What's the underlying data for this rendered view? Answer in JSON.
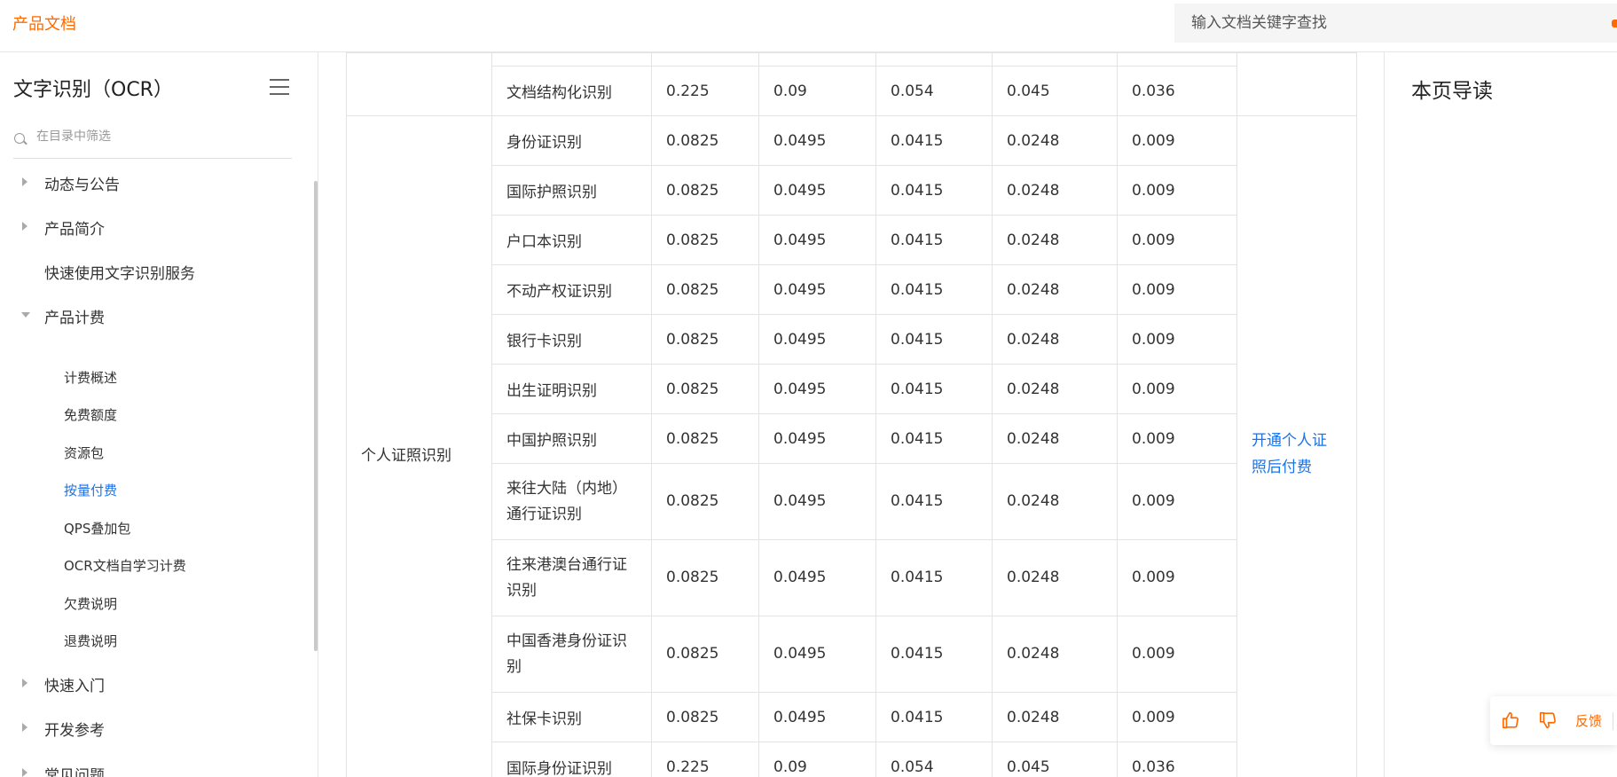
{
  "header": {
    "brand": "产品文档",
    "search_placeholder": "输入文档关键字查找"
  },
  "sidebar": {
    "title": "文字识别（OCR）",
    "filter_placeholder": "在目录中筛选",
    "items": [
      {
        "label": "动态与公告",
        "arrow": "right"
      },
      {
        "label": "产品简介",
        "arrow": "right"
      },
      {
        "label": "快速使用文字识别服务",
        "arrow": "none"
      },
      {
        "label": "产品计费",
        "arrow": "down"
      }
    ],
    "sub_items": [
      {
        "label": "计费概述"
      },
      {
        "label": "免费额度"
      },
      {
        "label": "资源包"
      },
      {
        "label": "按量付费",
        "active": true
      },
      {
        "label": "QPS叠加包"
      },
      {
        "label": "OCR文档自学习计费"
      },
      {
        "label": "欠费说明"
      },
      {
        "label": "退费说明"
      }
    ],
    "after_items": [
      {
        "label": "快速入门"
      },
      {
        "label": "开发参考"
      },
      {
        "label": "常见问题"
      }
    ]
  },
  "table": {
    "top_row": {
      "name": "文档结构化识别",
      "prices": [
        "0.225",
        "0.09",
        "0.054",
        "0.045",
        "0.036"
      ]
    },
    "group_label": "个人证照识别",
    "action_label": "开通个人证照后付费",
    "rows": [
      {
        "name": "身份证识别",
        "prices": [
          "0.0825",
          "0.0495",
          "0.0415",
          "0.0248",
          "0.009"
        ]
      },
      {
        "name": "国际护照识别",
        "prices": [
          "0.0825",
          "0.0495",
          "0.0415",
          "0.0248",
          "0.009"
        ]
      },
      {
        "name": "户口本识别",
        "prices": [
          "0.0825",
          "0.0495",
          "0.0415",
          "0.0248",
          "0.009"
        ]
      },
      {
        "name": "不动产权证识别",
        "prices": [
          "0.0825",
          "0.0495",
          "0.0415",
          "0.0248",
          "0.009"
        ]
      },
      {
        "name": "银行卡识别",
        "prices": [
          "0.0825",
          "0.0495",
          "0.0415",
          "0.0248",
          "0.009"
        ]
      },
      {
        "name": "出生证明识别",
        "prices": [
          "0.0825",
          "0.0495",
          "0.0415",
          "0.0248",
          "0.009"
        ]
      },
      {
        "name": "中国护照识别",
        "prices": [
          "0.0825",
          "0.0495",
          "0.0415",
          "0.0248",
          "0.009"
        ]
      },
      {
        "name": "来往大陆（内地）通行证识别",
        "prices": [
          "0.0825",
          "0.0495",
          "0.0415",
          "0.0248",
          "0.009"
        ]
      },
      {
        "name": "往来港澳台通行证识别",
        "prices": [
          "0.0825",
          "0.0495",
          "0.0415",
          "0.0248",
          "0.009"
        ]
      },
      {
        "name": "中国香港身份证识别",
        "prices": [
          "0.0825",
          "0.0495",
          "0.0415",
          "0.0248",
          "0.009"
        ]
      },
      {
        "name": "社保卡识别",
        "prices": [
          "0.0825",
          "0.0495",
          "0.0415",
          "0.0248",
          "0.009"
        ]
      },
      {
        "name": "国际身份证识别",
        "prices": [
          "0.225",
          "0.09",
          "0.054",
          "0.045",
          "0.036"
        ]
      }
    ]
  },
  "right_panel": {
    "title": "本页导读"
  },
  "feedback": {
    "label": "反馈",
    "like_icon": "thumbs-up-icon",
    "dislike_icon": "thumbs-down-icon"
  },
  "colors": {
    "brand": "#ff6a00",
    "link": "#1a73e8"
  }
}
